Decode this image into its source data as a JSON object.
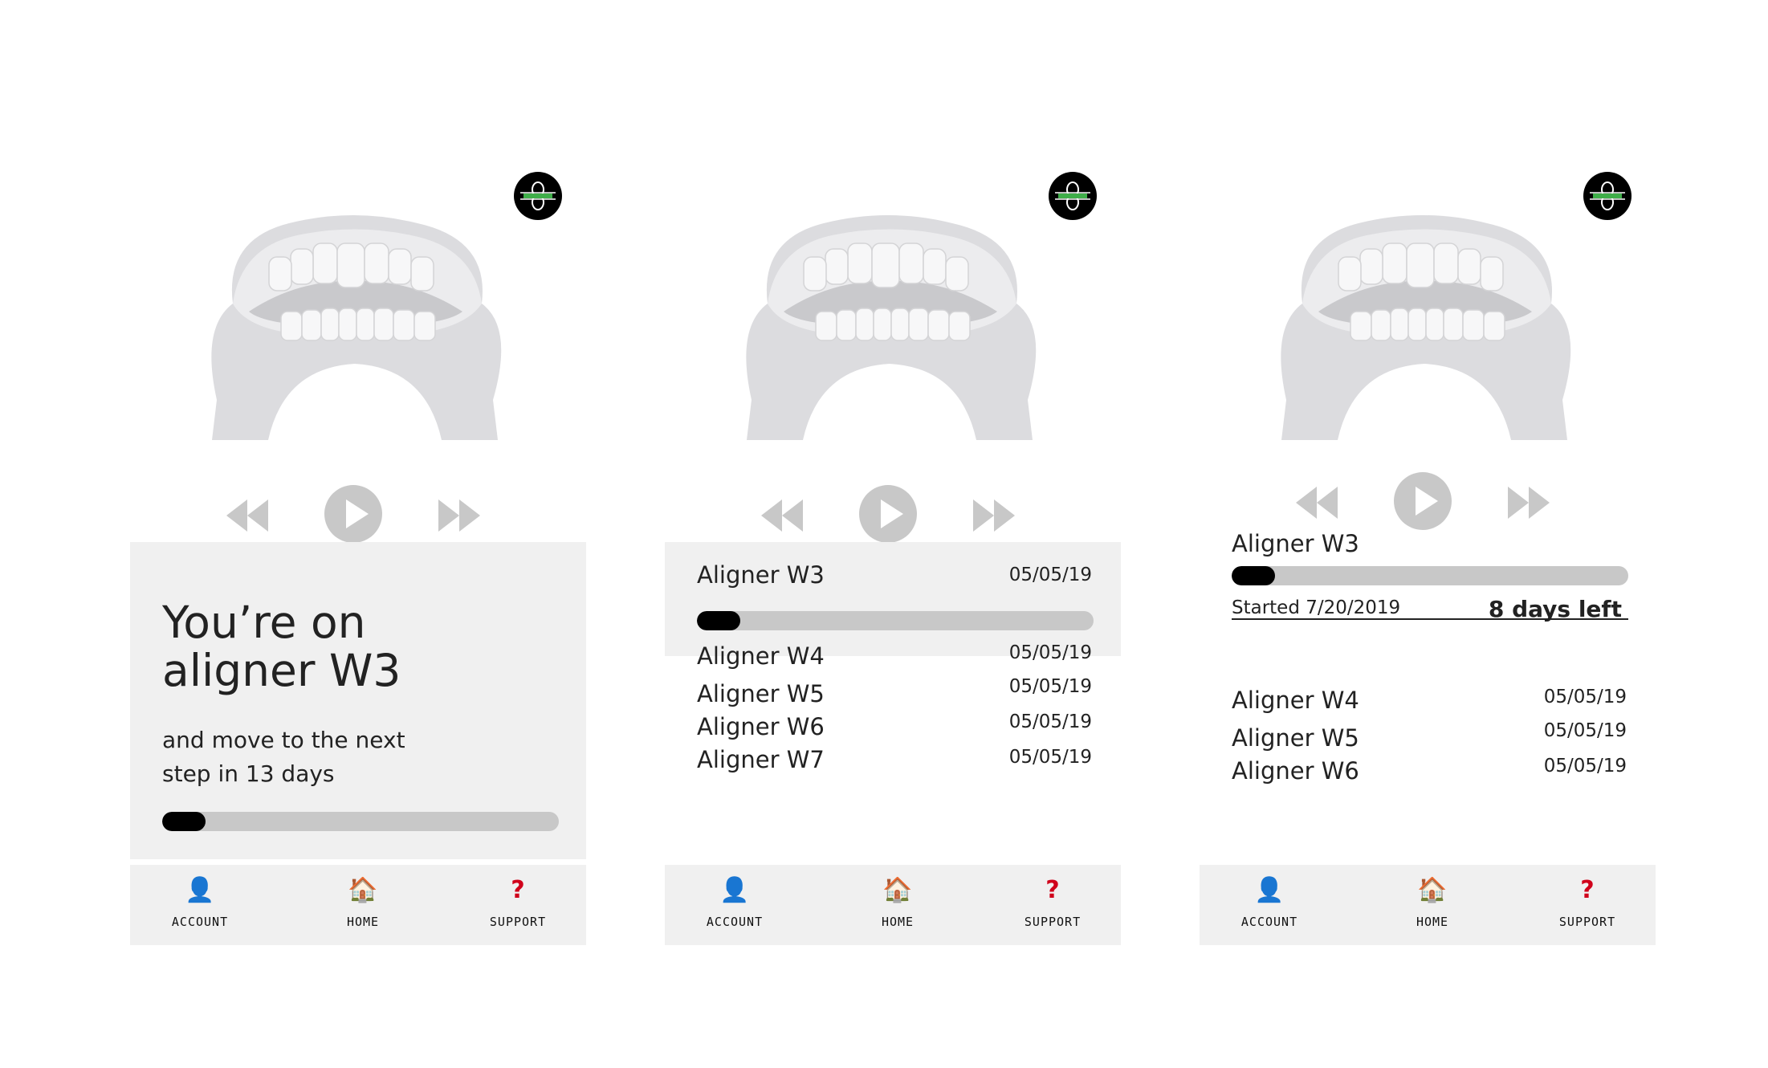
{
  "screens": [
    {
      "hero": {
        "title_line1": "You’re on",
        "title_line2": "aligner W3",
        "sub_line1": "and move to the next",
        "sub_line2": "step in 13 days",
        "progress": 0.11
      }
    },
    {
      "current": {
        "name": "Aligner W3",
        "date": "05/05/19",
        "progress": 0.11
      },
      "list": [
        {
          "name": "Aligner W4",
          "date": "05/05/19"
        },
        {
          "name": "Aligner W5",
          "date": "05/05/19"
        },
        {
          "name": "Aligner W6",
          "date": "05/05/19"
        },
        {
          "name": "Aligner W7",
          "date": "05/05/19"
        }
      ]
    },
    {
      "current": {
        "name": "Aligner W3",
        "started": "Started 7/20/2019",
        "days_left": "8 days left",
        "progress": 0.11
      },
      "list": [
        {
          "name": "Aligner W4",
          "date": "05/05/19"
        },
        {
          "name": "Aligner W5",
          "date": "05/05/19"
        },
        {
          "name": "Aligner W6",
          "date": "05/05/19"
        }
      ]
    }
  ],
  "nav": {
    "account": "ACCOUNT",
    "home": "HOME",
    "support": "SUPPORT"
  },
  "icons": {
    "account": "person-icon",
    "home": "house-icon",
    "support": "question-icon",
    "logo": "aligner-logo-icon"
  },
  "colors": {
    "panel": "#f0f0f0",
    "progress_track": "#c8c8c8",
    "progress_fill": "#000000",
    "controls": "#c8c8c8",
    "support_icon": "#d0021b",
    "logo_accent": "#3fae49"
  }
}
